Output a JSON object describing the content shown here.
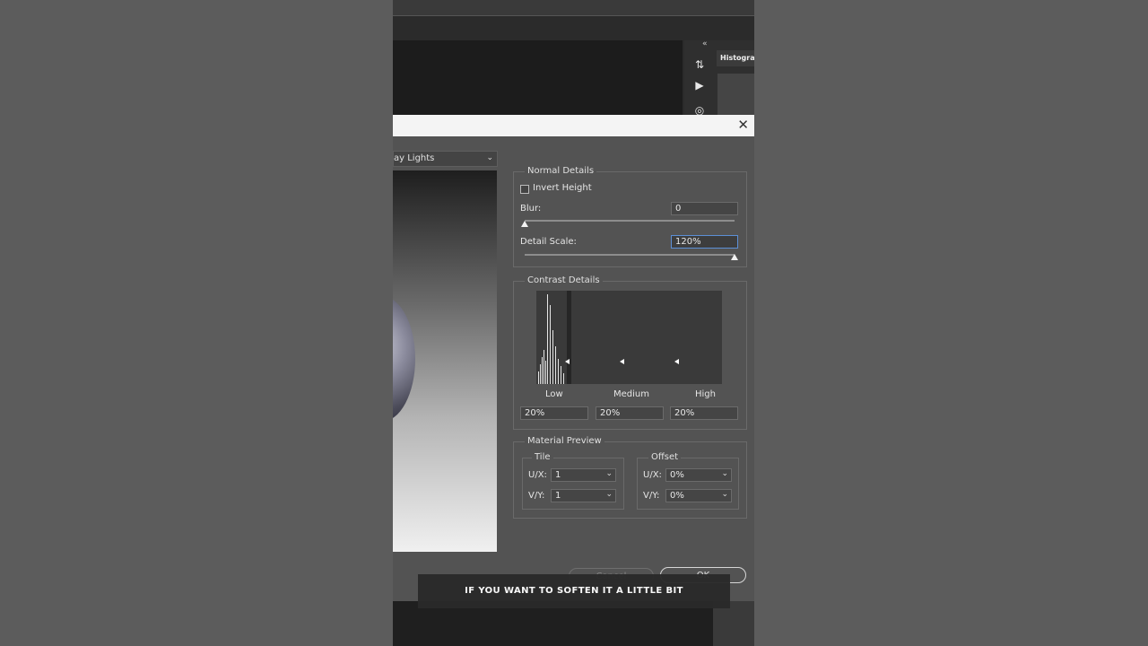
{
  "dialog": {
    "preset_value": "ay Lights",
    "close_glyph": "✕"
  },
  "dock": {
    "panel_tab": "Histogram",
    "collapse_glyph": "«"
  },
  "normal_details": {
    "title": "Normal Details",
    "invert_height_label": "Invert Height",
    "invert_height_checked": false,
    "blur_label": "Blur:",
    "blur_value": "0",
    "blur_level_percent": 0,
    "detail_scale_label": "Detail Scale:",
    "detail_scale_value": "120%",
    "detail_scale_level_percent": 100
  },
  "contrast_details": {
    "title": "Contrast Details",
    "labels": [
      "Low",
      "Medium",
      "High"
    ],
    "values": [
      "20%",
      "20%",
      "20%"
    ]
  },
  "material_preview": {
    "title": "Material Preview",
    "tile": {
      "title": "Tile",
      "ux_label": "U/X:",
      "ux_value": "1",
      "vy_label": "V/Y:",
      "vy_value": "1"
    },
    "offset": {
      "title": "Offset",
      "ux_label": "U/X:",
      "ux_value": "0%",
      "vy_label": "V/Y:",
      "vy_value": "0%"
    }
  },
  "buttons": {
    "cancel": "Cancel",
    "ok": "OK"
  },
  "caption": "IF YOU WANT TO SOFTEN IT A LITTLE BIT",
  "colors": {
    "accent_border": "#5c8fd6",
    "dialog_bg": "#535353"
  }
}
